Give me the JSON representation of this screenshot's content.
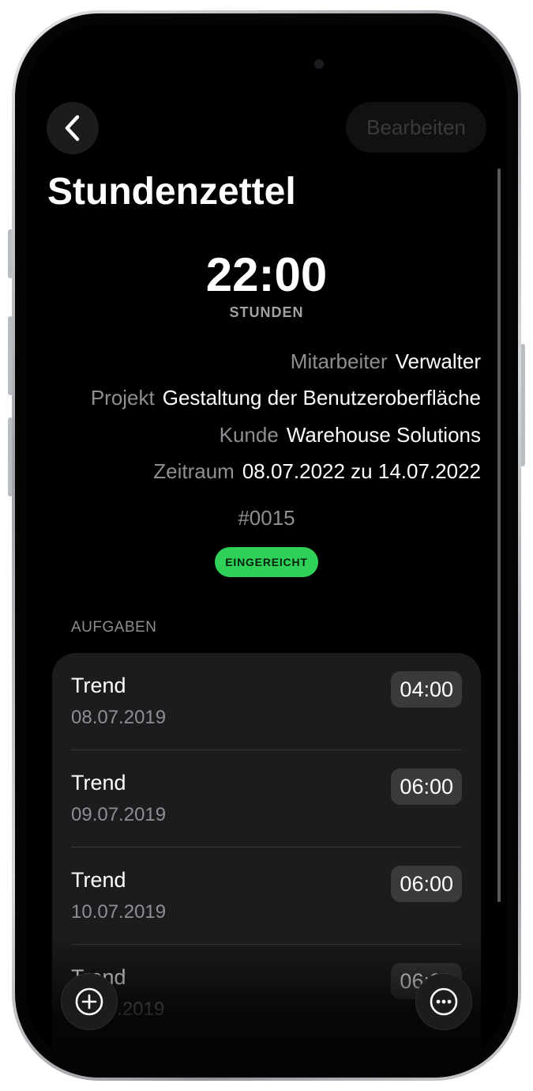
{
  "header": {
    "back_icon": "chevron-left-icon",
    "edit_label": "Bearbeiten"
  },
  "title": "Stundenzettel",
  "summary": {
    "hours": "22:00",
    "hours_label": "STUNDEN"
  },
  "info": {
    "employee_label": "Mitarbeiter",
    "employee_value": "Verwalter",
    "project_label": "Projekt",
    "project_value": "Gestaltung der Benutzeroberfläche",
    "client_label": "Kunde",
    "client_value": "Warehouse Solutions",
    "period_label": "Zeitraum",
    "period_value": "08.07.2022 zu 14.07.2022"
  },
  "number": "#0015",
  "status": {
    "label": "EINGEREICHT",
    "color": "#30d158"
  },
  "tasks_section": {
    "title": "AUFGABEN",
    "items": [
      {
        "name": "Trend",
        "date": "08.07.2019",
        "time": "04:00"
      },
      {
        "name": "Trend",
        "date": "09.07.2019",
        "time": "06:00"
      },
      {
        "name": "Trend",
        "date": "10.07.2019",
        "time": "06:00"
      },
      {
        "name": "Trend",
        "date": "11.07.2019",
        "time": "06:00"
      }
    ]
  },
  "fab": {
    "add_icon": "plus-circle-icon",
    "more_icon": "ellipsis-circle-icon"
  },
  "colors": {
    "background": "#000000",
    "card": "#1c1c1e",
    "secondary_text": "#8e8e93",
    "accent_green": "#30d158"
  }
}
